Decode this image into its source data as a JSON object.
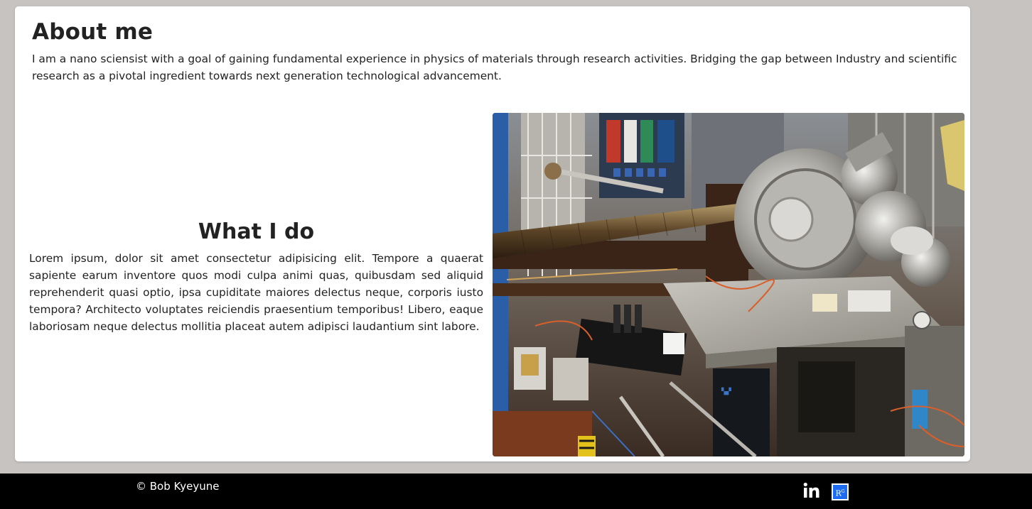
{
  "about": {
    "title": "About me",
    "text": "I am a nano sciensist with a goal of gaining fundamental experience in physics of materials through research activities. Bridging the gap between Industry and scientific research as a pivotal ingredient towards next generation technological advancement."
  },
  "whatido": {
    "title": "What I do",
    "text": "Lorem ipsum, dolor sit amet consectetur adipisicing elit. Tempore a quaerat sapiente earum inventore quos modi culpa animi quas, quibusdam sed aliquid reprehenderit quasi optio, ipsa cupiditate maiores delectus neque, corporis iusto tempora? Architecto voluptates reiciendis praesentium temporibus! Libero, eaque laboriosam neque delectus mollitia placeat autem adipisci laudantium sint labore."
  },
  "footer": {
    "copyright": "© Bob Kyeyune",
    "linkedin_icon": "linkedin-icon",
    "researchgate_label": "R",
    "researchgate_sup": "G"
  },
  "colors": {
    "page_bg": "#c6c3c1",
    "card_bg": "#ffffff",
    "footer_bg": "#000000",
    "researchgate_blue": "#1d6bf0"
  }
}
